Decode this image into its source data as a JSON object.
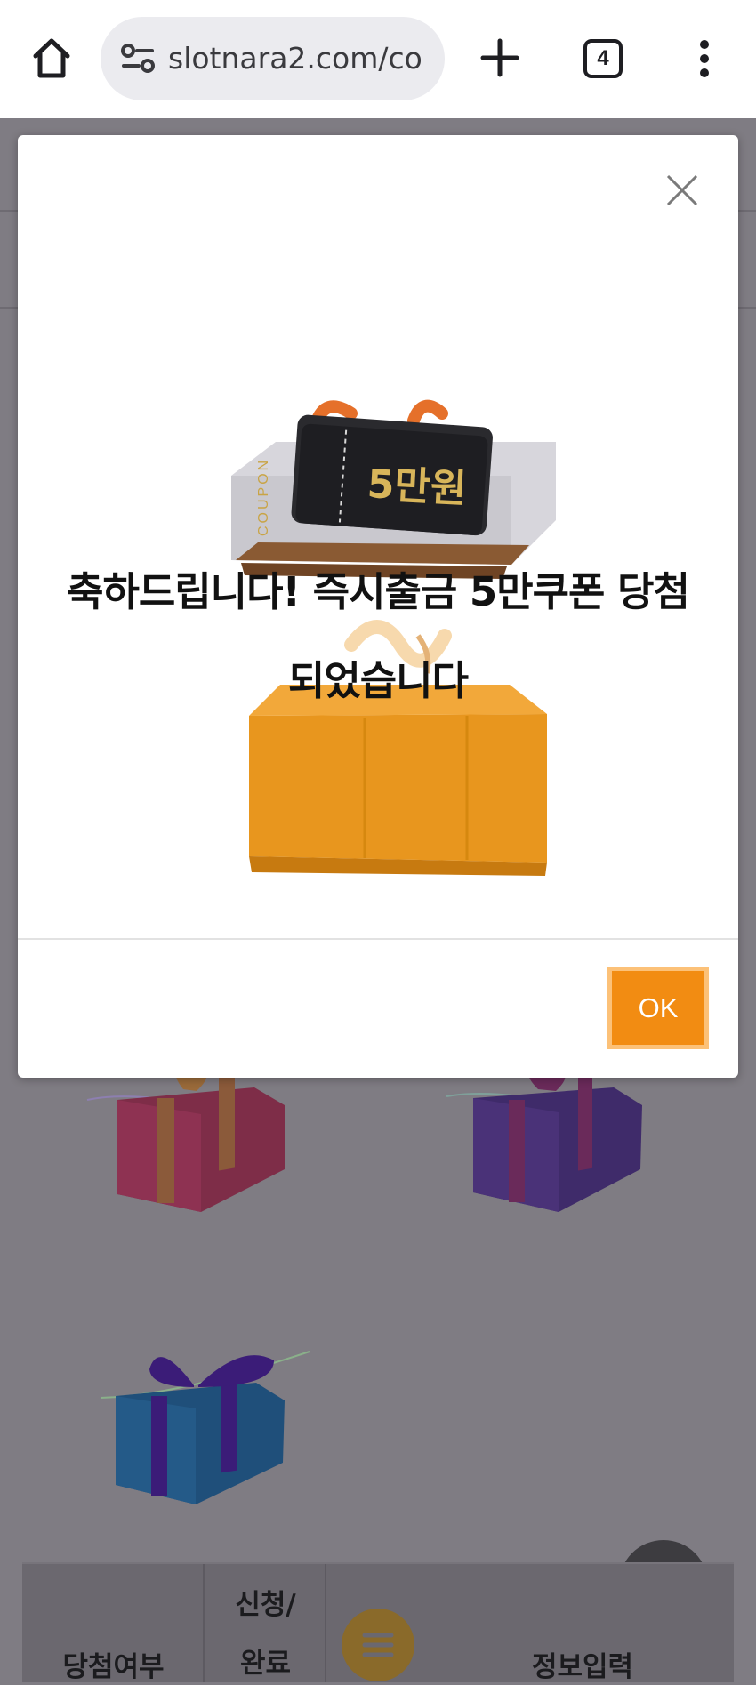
{
  "browser": {
    "url": "slotnara2.com/co",
    "tab_count": "4",
    "icons": [
      "home-icon",
      "site-settings-icon",
      "new-tab-icon",
      "tab-switcher-icon",
      "more-menu-icon"
    ]
  },
  "modal": {
    "coupon_label": "COUPON",
    "coupon_value": "5만원",
    "headline_line1": "축하드립니다! 즉시출금 5만쿠폰 당첨",
    "headline_line2": "되었습니다",
    "ok_label": "OK",
    "close_icon": "close-icon"
  },
  "bottom_nav": {
    "item1": "당첨여부",
    "item2_line1": "신청/",
    "item2_line2": "완료",
    "item3": "정보입력",
    "menu_icon": "hamburger-icon"
  },
  "colors": {
    "accent": "#f28c12",
    "overlay": "#7f7c83"
  }
}
